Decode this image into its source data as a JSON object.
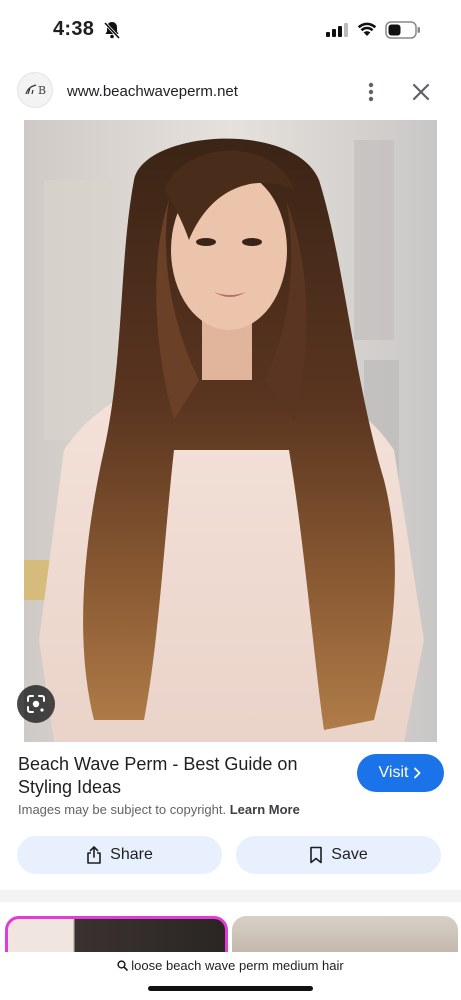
{
  "status_bar": {
    "time": "4:38"
  },
  "browser": {
    "url": "www.beachwaveperm.net",
    "logo_text": "B"
  },
  "result": {
    "title": "Beach Wave Perm - Best Guide on Styling Ideas",
    "visit_label": "Visit",
    "copyright_text": "Images may be subject to copyright.",
    "learn_more": "Learn More"
  },
  "actions": {
    "share_label": "Share",
    "save_label": "Save"
  },
  "search": {
    "query": "loose beach wave perm medium hair"
  },
  "colors": {
    "accent": "#1a73e8",
    "pill_bg": "#e8f0fe",
    "thumb_border": "#e23cd6"
  }
}
